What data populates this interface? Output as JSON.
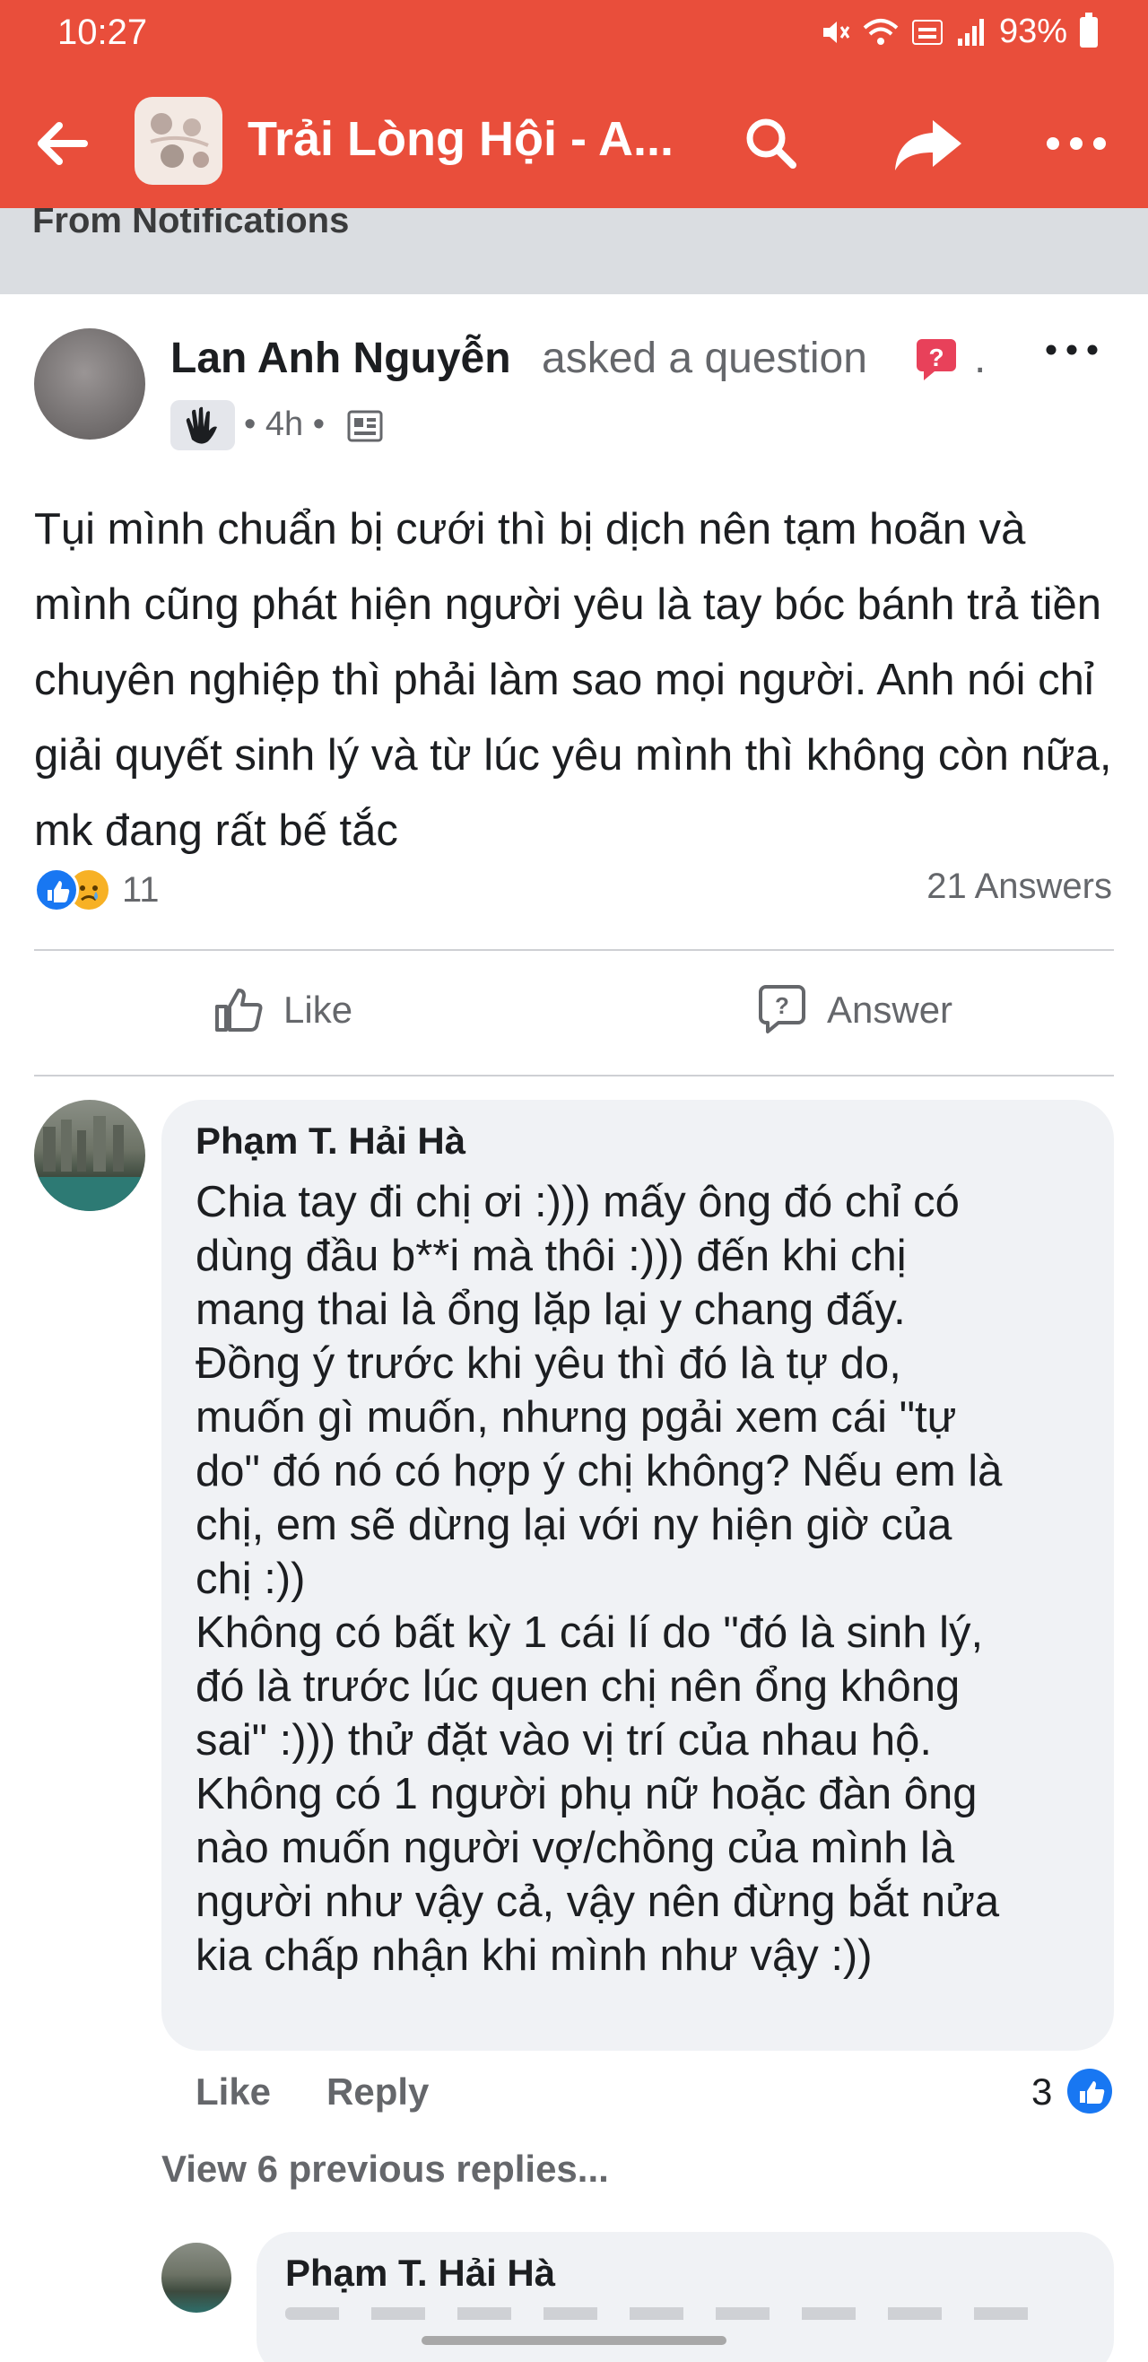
{
  "status_bar": {
    "time": "10:27",
    "battery": "93%",
    "icons": [
      "mute-icon",
      "wifi-icon",
      "volte-icon",
      "signal-icon",
      "battery-icon"
    ]
  },
  "app_bar": {
    "title": "Trải Lòng Hội - A...",
    "icons": [
      "back-arrow-icon",
      "group-avatar",
      "search-icon",
      "share-icon",
      "more-icon"
    ],
    "color": "#e94e3b"
  },
  "banner": {
    "text": "From Notifications"
  },
  "post": {
    "author": "Lan Anh Nguyễn",
    "action": "asked a question",
    "time": "4h",
    "meta_sep": "•",
    "body": "Tụi mình chuẩn bị cưới thì bị dịch nên tạm hoãn và mình cũng phát hiện người yêu là tay bóc bánh trả tiền chuyên nghiệp thì phải làm sao mọi người. Anh nói chỉ giải quyết sinh lý và từ lúc yêu mình thì không còn nữa, mk đang rất bế tắc",
    "reaction_count": "11",
    "answers": "21 Answers",
    "like_label": "Like",
    "answer_label": "Answer"
  },
  "comment": {
    "author": "Phạm T. Hải Hà",
    "body": "Chia tay đi chị ơi :))) mấy ông đó chỉ có\ndùng đầu b**i mà thôi :))) đến khi chị\nmang thai là ổng lặp lại y chang đấy.\nĐồng ý trước khi yêu thì đó là tự do,\nmuốn gì muốn, nhưng pgải xem cái \"tự\ndo\" đó nó có hợp ý chị không? Nếu em là\nchị, em sẽ dừng lại với ny hiện giờ của\nchị :))\nKhông có bất kỳ 1 cái lí do \"đó là sinh lý,\nđó là trước lúc quen chị nên ổng không\nsai\" :))) thử đặt vào vị trí của nhau hộ.\nKhông có 1 người phụ nữ hoặc đàn ông\nnào muốn người vợ/chồng của mình là\nngười như vậy cả, vậy nên đừng bắt nửa\nkia chấp nhận khi mình như vậy :))",
    "like_label": "Like",
    "reply_label": "Reply",
    "reaction_count": "3"
  },
  "replies": {
    "view_previous": "View 6 previous replies...",
    "latest_author": "Phạm T. Hải Hà"
  }
}
